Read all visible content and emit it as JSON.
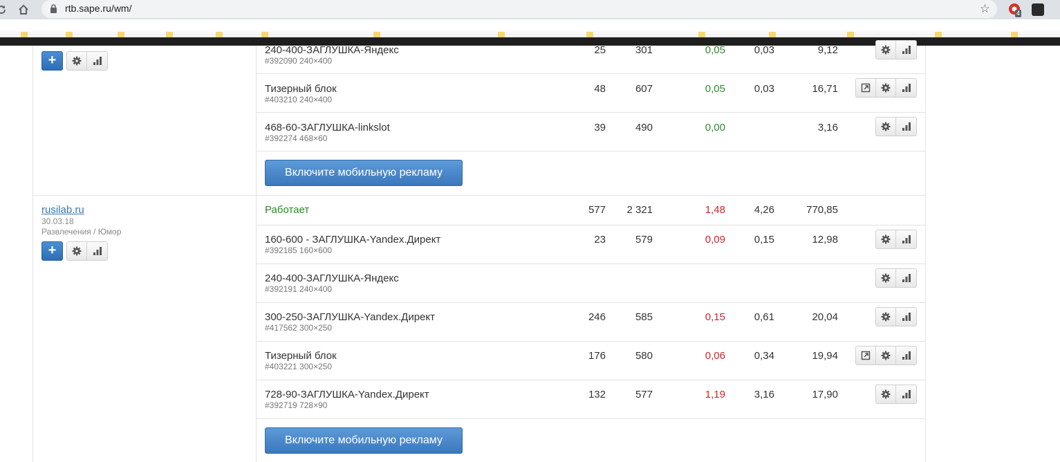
{
  "browser": {
    "url": "rtb.sape.ru/wm/",
    "ext_badge": "4"
  },
  "mobile_button_label": "Включите мобильную рекламу",
  "site1": {
    "rows": [
      {
        "name": "240-400-ЗАГЛУШКА-Яндекс",
        "meta": "#392090 240×400",
        "c1": "25",
        "c2": "301",
        "c3": "0,05",
        "c4": "0,03",
        "c5": "9,12"
      },
      {
        "name": "Тизерный блок",
        "meta": "#403210 240×400",
        "c1": "48",
        "c2": "607",
        "c3": "0,05",
        "c4": "0,03",
        "c5": "16,71"
      },
      {
        "name": "468-60-ЗАГЛУШКА-linkslot",
        "meta": "#392274 468×60",
        "c1": "39",
        "c2": "490",
        "c3": "0,00",
        "c4": "",
        "c5": "3,16"
      }
    ]
  },
  "site2": {
    "link": "rusilab.ru",
    "date": "30.03.18",
    "category": "Развлечения / Юмор",
    "status": "Работает",
    "totals": {
      "c1": "577",
      "c2": "2 321",
      "c3": "1,48",
      "c4": "4,26",
      "c5": "770,85"
    },
    "rows": [
      {
        "name": "160-600 - ЗАГЛУШКА-Yandex.Директ",
        "meta": "#392185 160×600",
        "c1": "23",
        "c2": "579",
        "c3": "0,09",
        "c4": "0,15",
        "c5": "12,98"
      },
      {
        "name": "240-400-ЗАГЛУШКА-Яндекс",
        "meta": "#392191 240×400",
        "c1": "",
        "c2": "",
        "c3": "",
        "c4": "",
        "c5": ""
      },
      {
        "name": "300-250-ЗАГЛУШКА-Yandex.Директ",
        "meta": "#417562 300×250",
        "c1": "246",
        "c2": "585",
        "c3": "0,15",
        "c4": "0,61",
        "c5": "20,04"
      },
      {
        "name": "Тизерный блок",
        "meta": "#403221 300×250",
        "c1": "176",
        "c2": "580",
        "c3": "0,06",
        "c4": "0,34",
        "c5": "19,94"
      },
      {
        "name": "728-90-ЗАГЛУШКА-Yandex.Директ",
        "meta": "#392719 728×90",
        "c1": "132",
        "c2": "577",
        "c3": "1,19",
        "c4": "3,16",
        "c5": "17,90"
      }
    ]
  }
}
